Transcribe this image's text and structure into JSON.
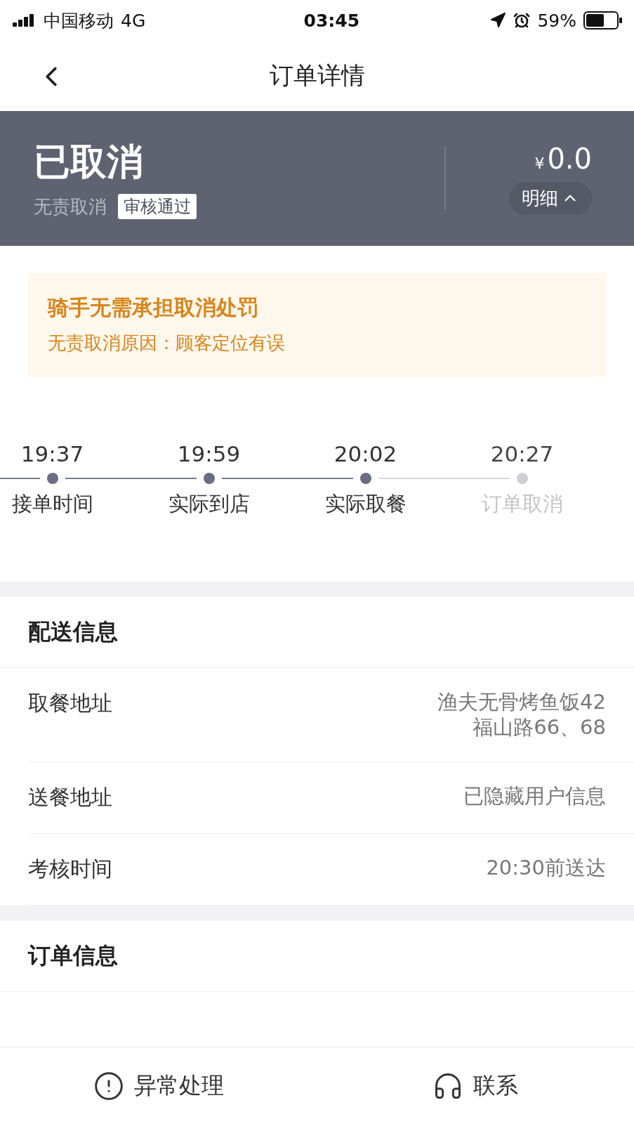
{
  "status_bar": {
    "carrier": "中国移动",
    "network": "4G",
    "time": "03:45",
    "battery": "59%"
  },
  "nav": {
    "title": "订单详情"
  },
  "header": {
    "status": "已取消",
    "reason": "无责取消",
    "badge": "审核通过",
    "currency": "¥",
    "amount": "0.0",
    "detail_button": "明细"
  },
  "notice": {
    "title": "骑手无需承担取消处罚",
    "text": "无责取消原因：顾客定位有误"
  },
  "timeline": [
    {
      "time": "19:37",
      "label": "接单时间",
      "done": true
    },
    {
      "time": "19:59",
      "label": "实际到店",
      "done": true
    },
    {
      "time": "20:02",
      "label": "实际取餐",
      "done": true
    },
    {
      "time": "20:27",
      "label": "订单取消",
      "done": false
    }
  ],
  "sections": [
    {
      "title": "配送信息",
      "rows": [
        {
          "label": "取餐地址",
          "value_lines": [
            "渔夫无骨烤鱼饭42",
            "福山路66、68"
          ]
        },
        {
          "label": "送餐地址",
          "value_lines": [
            "已隐藏用户信息"
          ]
        },
        {
          "label": "考核时间",
          "value_lines": [
            "20:30前送达"
          ]
        }
      ]
    },
    {
      "title": "订单信息"
    }
  ],
  "bottom_actions": [
    {
      "kind": "alert",
      "label": "异常处理"
    },
    {
      "kind": "headset",
      "label": "联系"
    }
  ]
}
